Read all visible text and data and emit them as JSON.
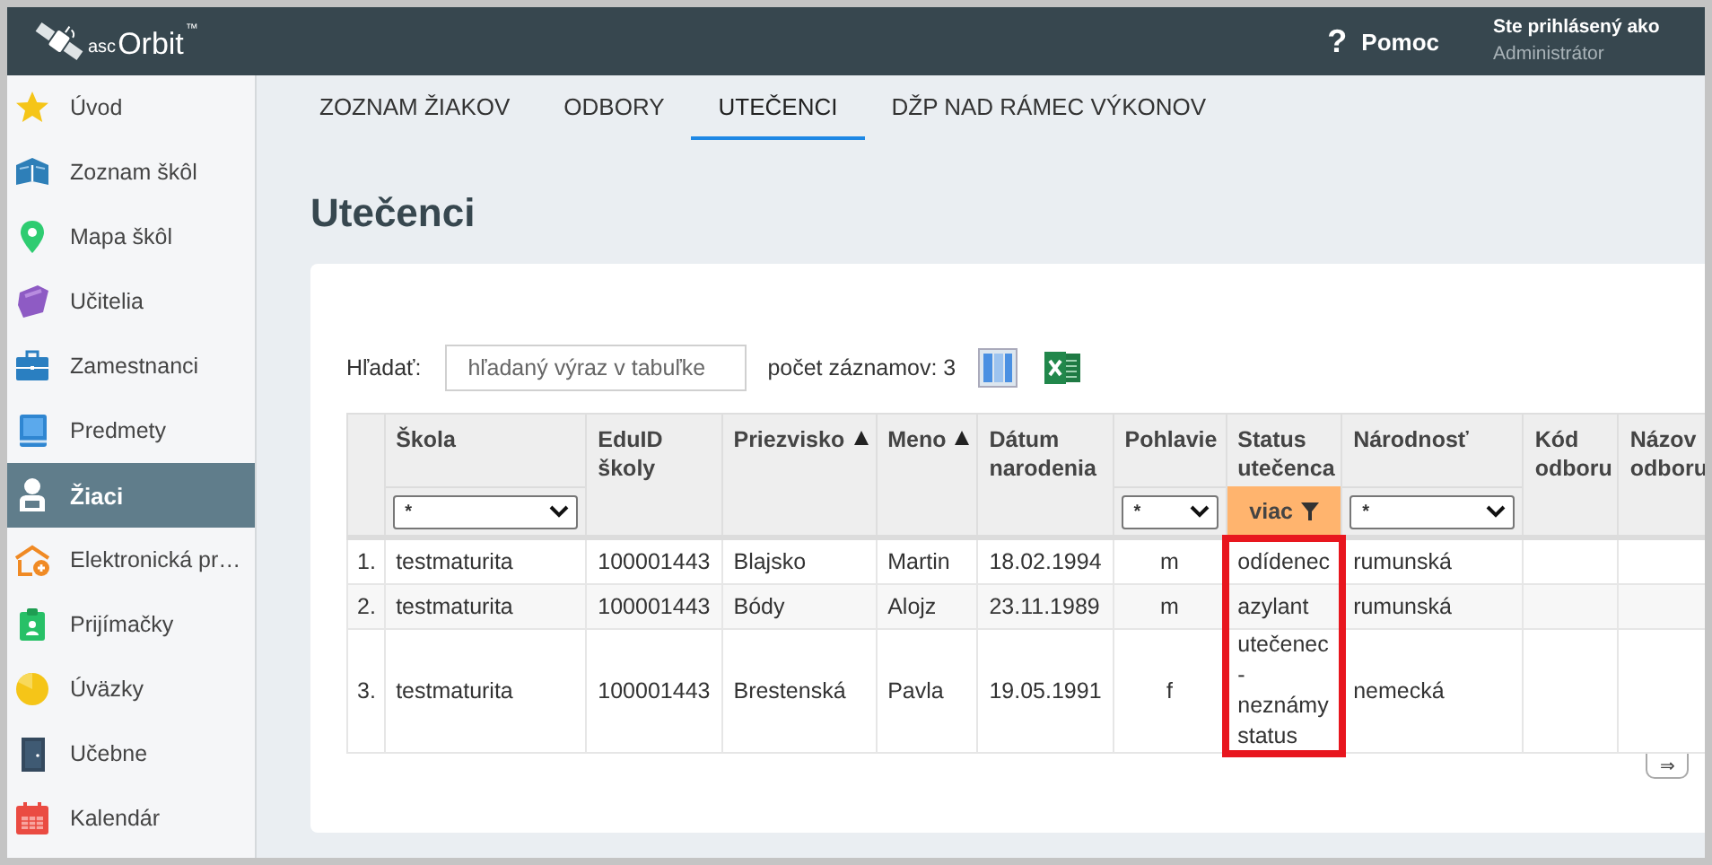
{
  "app": {
    "logo_prefix": "asc",
    "logo_name": "Orbit",
    "logo_mark": "™"
  },
  "header": {
    "help_symbol": "?",
    "help": "Pomoc",
    "login_label": "Ste prihlásený ako",
    "user": "Administrátor"
  },
  "sidebar": {
    "items": [
      {
        "label": "Úvod",
        "selected": false
      },
      {
        "label": "Zoznam škôl",
        "selected": false
      },
      {
        "label": "Mapa škôl",
        "selected": false
      },
      {
        "label": "Učitelia",
        "selected": false
      },
      {
        "label": "Zamestnanci",
        "selected": false
      },
      {
        "label": "Predmety",
        "selected": false
      },
      {
        "label": "Žiaci",
        "selected": true
      },
      {
        "label": "Elektronická pr…",
        "selected": false
      },
      {
        "label": "Prijímačky",
        "selected": false
      },
      {
        "label": "Úväzky",
        "selected": false
      },
      {
        "label": "Učebne",
        "selected": false
      },
      {
        "label": "Kalendár",
        "selected": false
      }
    ]
  },
  "tabs": [
    {
      "label": "ZOZNAM ŽIAKOV",
      "selected": false
    },
    {
      "label": "ODBORY",
      "selected": false
    },
    {
      "label": "UTEČENCI",
      "selected": true
    },
    {
      "label": "DŽP NAD RÁMEC VÝKONOV",
      "selected": false
    }
  ],
  "title": "Utečenci",
  "search": {
    "label": "Hľadať:",
    "placeholder": "hľadaný výraz v tabuľke"
  },
  "record_count": "počet záznamov: 3",
  "table": {
    "columns": [
      {
        "label": "Škola",
        "sorted": false,
        "filter": {
          "kind": "select",
          "value": "*"
        },
        "highlighted": false
      },
      {
        "label": "EduID školy",
        "sorted": false,
        "highlighted": false
      },
      {
        "label": "Priezvisko",
        "sorted": true,
        "highlighted": false
      },
      {
        "label": "Meno",
        "sorted": true,
        "highlighted": false
      },
      {
        "label": "Dátum narodenia",
        "sorted": false,
        "highlighted": false
      },
      {
        "label": "Pohlavie",
        "sorted": false,
        "filter": {
          "kind": "select",
          "value": "*"
        },
        "highlighted": false
      },
      {
        "label": "Status utečenca",
        "sorted": false,
        "filter": {
          "kind": "button",
          "label": "viac",
          "active": true
        },
        "highlighted": true
      },
      {
        "label": "Národnosť",
        "sorted": false,
        "filter": {
          "kind": "select",
          "value": "*"
        },
        "highlighted": false
      },
      {
        "label": "Kód odboru",
        "sorted": false,
        "highlighted": false
      },
      {
        "label": "Názov odboru",
        "sorted": false,
        "highlighted": false
      }
    ],
    "rows": [
      {
        "number": "1.",
        "cells": [
          "testmaturita",
          "100001443",
          "Blajsko",
          "Martin",
          "18.02.1994",
          "m",
          "odídenec",
          "rumunská"
        ]
      },
      {
        "number": "2.",
        "cells": [
          "testmaturita",
          "100001443",
          "Bódy",
          "Alojz",
          "23.11.1989",
          "m",
          "azylant",
          "rumunská"
        ]
      },
      {
        "number": "3.",
        "cells": [
          "testmaturita",
          "100001443",
          "Brestenská",
          "Pavla",
          "19.05.1991",
          "f",
          "utečenec - neznámy status",
          "nemecká"
        ]
      }
    ],
    "scroll_button": "⇒"
  }
}
